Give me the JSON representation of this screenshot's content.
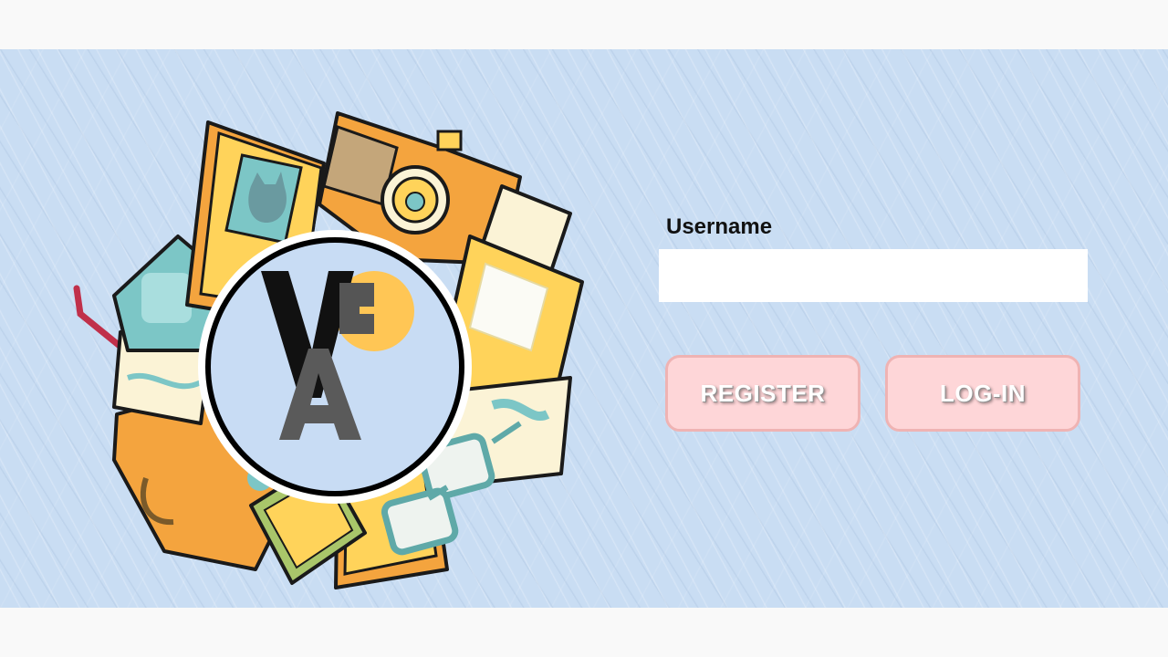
{
  "logo": {
    "letters": [
      "V",
      "C",
      "A"
    ],
    "colors": {
      "circle_fill": "#c8dcf4",
      "accent_circle": "#ffc655",
      "letter_v": "#111111",
      "letter_ca": "#5a5a5a"
    }
  },
  "login_form": {
    "username_label": "Username",
    "username_value": "",
    "buttons": {
      "register": "REGISTER",
      "login": "LOG-IN"
    }
  },
  "theme": {
    "background": "#c9ddf3",
    "button_fill": "#fed6d8",
    "button_border": "#efb3b3",
    "button_text": "#ffffff"
  }
}
